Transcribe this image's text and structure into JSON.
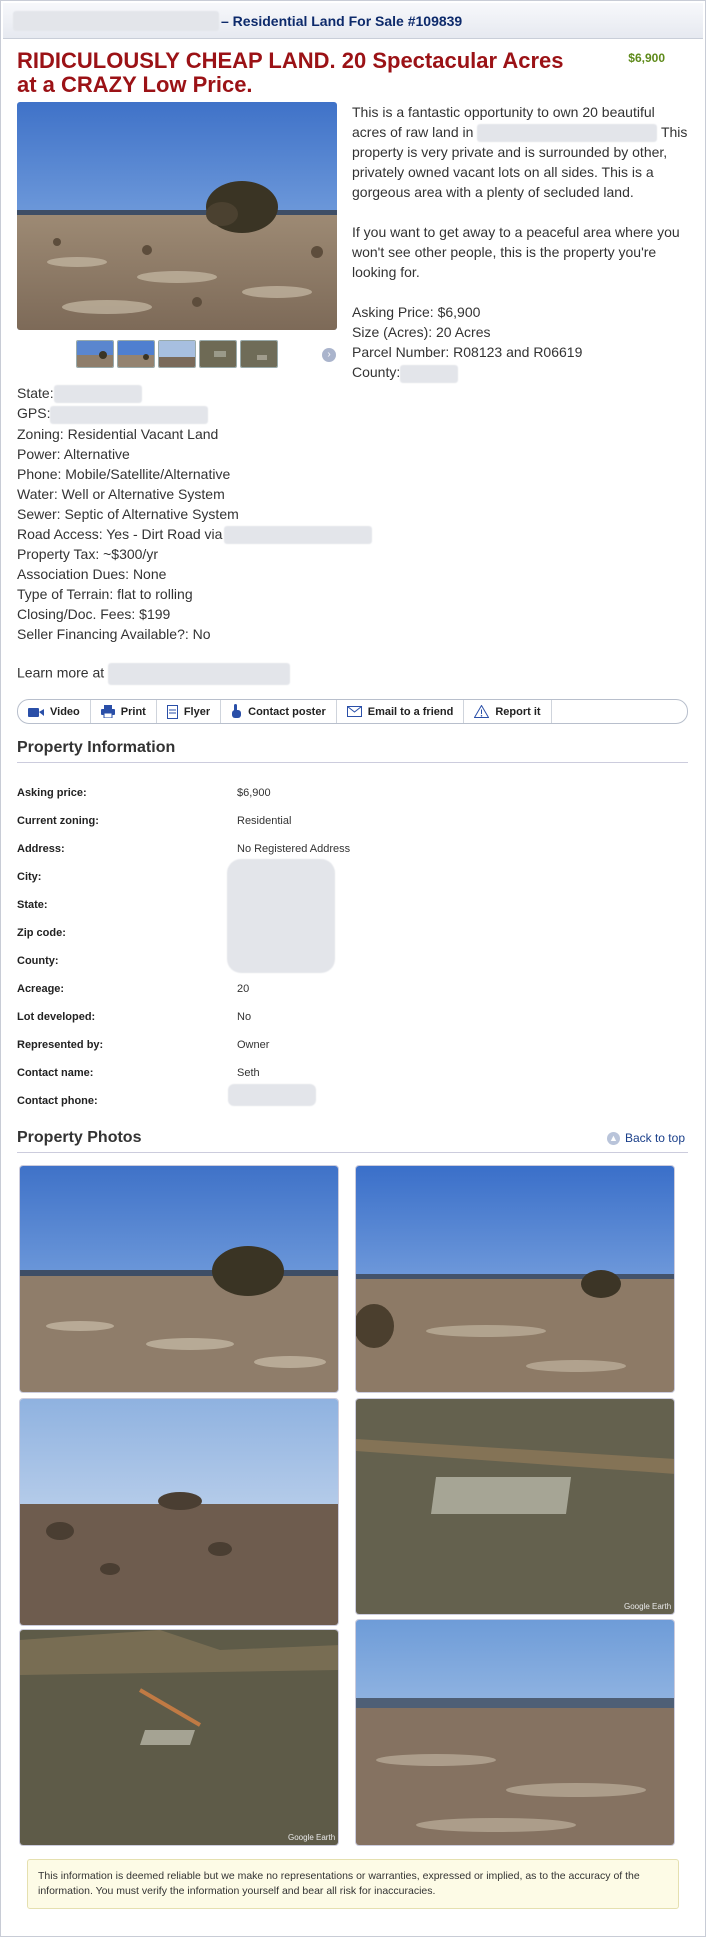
{
  "header": {
    "title_suffix": "– Residential Land For Sale #109839"
  },
  "listing": {
    "headline": "RIDICULOUSLY CHEAP LAND. 20 Spectacular Acres at a CRAZY Low Price.",
    "price_badge": "$6,900"
  },
  "description": {
    "p1_start": "This is a fantastic opportunity to own 20 beautiful acres of raw land in",
    "p1_end": "This property is very private and is surrounded by other, privately owned vacant lots on all sides. This is a gorgeous area with a plenty of secluded land.",
    "p2": "If you want to get away to a peaceful area where you won't see other people, this is the property you're looking for.",
    "asking_price": "Asking Price: $6,900",
    "size": "Size (Acres): 20 Acres",
    "parcel": "Parcel Number: R08123 and R06619",
    "county_label": "County:"
  },
  "facts": {
    "state": "State:",
    "gps": "GPS:",
    "zoning": "Zoning: Residential Vacant Land",
    "power": "Power: Alternative",
    "phone": "Phone: Mobile/Satellite/Alternative",
    "water": "Water: Well or Alternative System",
    "sewer": "Sewer: Septic of Alternative System",
    "road": "Road Access: Yes - Dirt Road via",
    "tax": "Property Tax: ~$300/yr",
    "dues": "Association Dues: None",
    "terrain": "Type of Terrain: flat to rolling",
    "closing": "Closing/Doc. Fees: $199",
    "financing": "Seller Financing Available?: No",
    "learn_more": "Learn more at"
  },
  "toolbar": {
    "video": "Video",
    "print": "Print",
    "flyer": "Flyer",
    "contact": "Contact poster",
    "email": "Email to a friend",
    "report": "Report it"
  },
  "property_info": {
    "title": "Property Information",
    "rows": [
      {
        "label": "Asking price:",
        "value": "$6,900"
      },
      {
        "label": "Current zoning:",
        "value": "Residential"
      },
      {
        "label": "Address:",
        "value": "No Registered Address"
      },
      {
        "label": "City:",
        "value": ""
      },
      {
        "label": "State:",
        "value": ""
      },
      {
        "label": "Zip code:",
        "value": ""
      },
      {
        "label": "County:",
        "value": ""
      },
      {
        "label": "Acreage:",
        "value": "20"
      },
      {
        "label": "Lot developed:",
        "value": "No"
      },
      {
        "label": "Represented by:",
        "value": "Owner"
      },
      {
        "label": "Contact name:",
        "value": "Seth"
      },
      {
        "label": "Contact phone:",
        "value": ""
      }
    ]
  },
  "photos": {
    "title": "Property Photos",
    "back_to_top": "Back to top",
    "watermark": "Google Earth"
  },
  "disclaimer": "This information is deemed reliable but we make no representations or warranties, expressed or implied, as to the accuracy of the information. You must verify the information yourself and bear all risk for inaccuracies.",
  "colors": {
    "headline": "#9b1216",
    "price": "#5e8a1a",
    "link": "#1a3f8a",
    "header_text": "#0d2a6b"
  }
}
